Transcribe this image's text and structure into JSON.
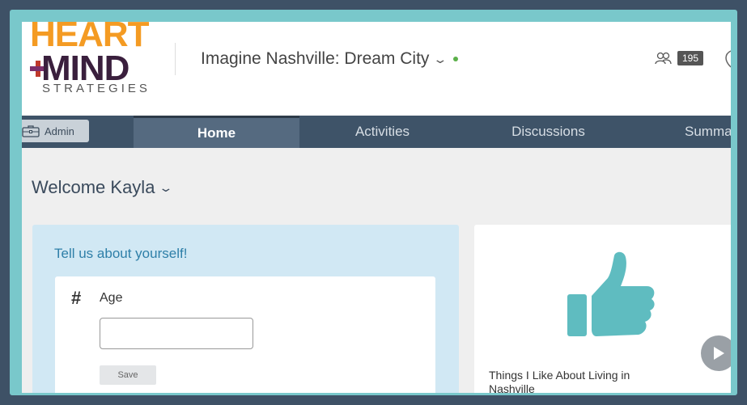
{
  "header": {
    "logo": {
      "line1": "HEART",
      "line2": "MIND",
      "line3": "STRATEGIES"
    },
    "event_title": "Imagine Nashville: Dream City",
    "participant_count": "195",
    "status_color": "#5bb04a"
  },
  "nav": {
    "admin_label": "Admin",
    "tabs": [
      {
        "label": "Home",
        "active": true
      },
      {
        "label": "Activities",
        "active": false
      },
      {
        "label": "Discussions",
        "active": false
      },
      {
        "label": "Summa",
        "active": false
      }
    ]
  },
  "welcome": {
    "text": "Welcome Kayla"
  },
  "profile_card": {
    "heading": "Tell us about yourself!",
    "field_icon": "hash-icon",
    "field_label": "Age",
    "field_value": "",
    "save_label": "Save"
  },
  "activity_card": {
    "icon": "thumbs-up-icon",
    "title": "Things I Like About Living in Nashville",
    "accent_color": "#5fbcc0"
  },
  "colors": {
    "nav_bg": "#3e5368",
    "active_tab_bg": "#556a80",
    "frame": "#79c8cb",
    "heading_blue": "#2e7fa8"
  }
}
